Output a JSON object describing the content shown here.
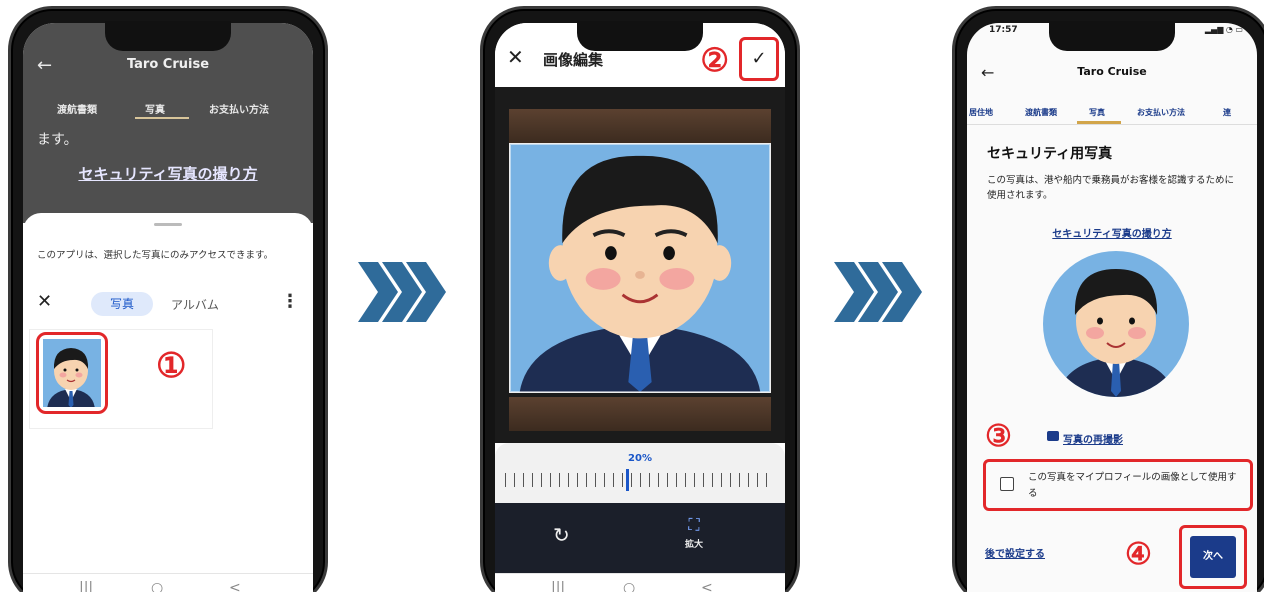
{
  "colors": {
    "accent_red": "#e2272a",
    "navy": "#1b3b8a",
    "chevron": "#2f6b9a",
    "photo_bg": "#78b2e3"
  },
  "screen1": {
    "app_title": "Taro Cruise",
    "tabs": [
      "渡航書類",
      "写真",
      "お支払い方法"
    ],
    "masu_text": "ます。",
    "security_link": "セキュリティ写真の撮り方",
    "sheet_note": "このアプリは、選択した写真にのみアクセスできます。",
    "tab_photo": "写真",
    "tab_album": "アルバム",
    "step": "①",
    "nav": [
      "|||",
      "○",
      "<"
    ]
  },
  "screen2": {
    "title": "画像編集",
    "check": "✓",
    "step": "②",
    "zoom_percent": "20%",
    "expand_label": "拡大",
    "nav": [
      "|||",
      "○",
      "<"
    ]
  },
  "screen3": {
    "time": "17:57",
    "app_title": "Taro Cruise",
    "tabs": [
      "居住地",
      "渡航書類",
      "写真",
      "お支払い方法",
      "連"
    ],
    "heading": "セキュリティ用写真",
    "description": "この写真は、港や船内で乗務員がお客様を認識するために使用されます。",
    "security_link": "セキュリティ写真の撮り方",
    "retake": "写真の再撮影",
    "checkbox_label": "この写真をマイプロフィールの画像として使用する",
    "later": "後で設定する",
    "next": "次へ",
    "step3": "③",
    "step4": "④"
  }
}
